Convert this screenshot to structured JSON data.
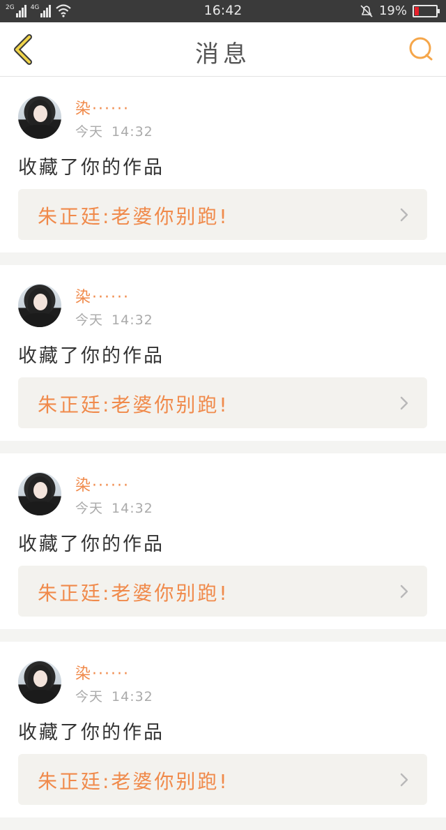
{
  "status_bar": {
    "net1_label": "2G",
    "net2_label": "4G",
    "time": "16:42",
    "battery_text": "19%",
    "battery_level": 0.19,
    "battery_color": "#e8202a"
  },
  "header": {
    "title": "消息",
    "back_icon": "chevron-left-icon",
    "search_icon": "search-icon",
    "accent": "#f5a64a"
  },
  "feed": {
    "items": [
      {
        "username": "染······",
        "day": "今天",
        "time": "14:32",
        "action": "收藏了你的作品",
        "work_title": "朱正廷:老婆你别跑!"
      },
      {
        "username": "染······",
        "day": "今天",
        "time": "14:32",
        "action": "收藏了你的作品",
        "work_title": "朱正廷:老婆你别跑!"
      },
      {
        "username": "染······",
        "day": "今天",
        "time": "14:32",
        "action": "收藏了你的作品",
        "work_title": "朱正廷:老婆你别跑!"
      },
      {
        "username": "染······",
        "day": "今天",
        "time": "14:32",
        "action": "收藏了你的作品",
        "work_title": "朱正廷:老婆你别跑!"
      }
    ]
  },
  "colors": {
    "accent_orange": "#f08a4b",
    "card_bg": "#ffffff",
    "page_bg": "#f4f4f2"
  }
}
